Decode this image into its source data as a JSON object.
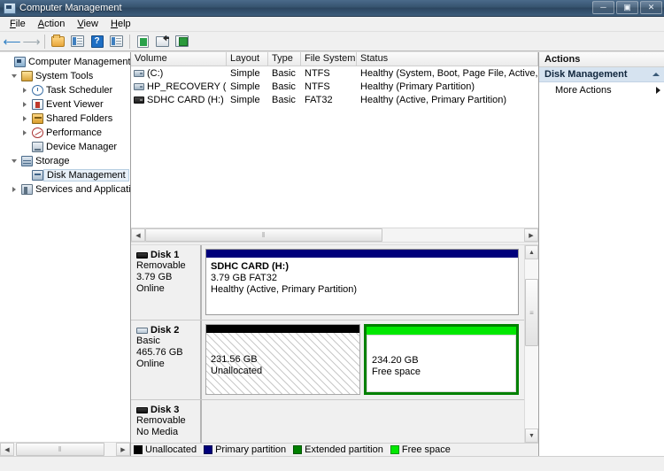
{
  "window": {
    "title": "Computer Management",
    "icon": "computer-management-icon",
    "buttons": {
      "minimize": "─",
      "maximize": "▣",
      "close": "✕"
    }
  },
  "menubar": {
    "items": [
      {
        "label": "File",
        "accel": "F"
      },
      {
        "label": "Action",
        "accel": "A"
      },
      {
        "label": "View",
        "accel": "V"
      },
      {
        "label": "Help",
        "accel": "H"
      }
    ]
  },
  "toolbar": {
    "buttons": [
      {
        "name": "back-icon",
        "glyph": "←"
      },
      {
        "name": "forward-icon",
        "glyph": "→"
      },
      {
        "name": "up-folder-icon",
        "glyph": ""
      },
      {
        "name": "show-hide-tree-icon",
        "glyph": ""
      },
      {
        "name": "help-icon",
        "glyph": "?"
      },
      {
        "name": "show-hide-actions-icon",
        "glyph": ""
      },
      {
        "name": "refresh-icon",
        "glyph": ""
      },
      {
        "name": "export-list-icon",
        "glyph": ""
      },
      {
        "name": "properties-icon",
        "glyph": ""
      }
    ]
  },
  "tree": {
    "root": {
      "label": "Computer Management (Local)",
      "icon": "computer-icon"
    },
    "items": [
      {
        "label": "System Tools",
        "icon": "system-tools-icon",
        "level": 1,
        "twisty": "open"
      },
      {
        "label": "Task Scheduler",
        "icon": "clock-icon",
        "level": 2,
        "twisty": "closed"
      },
      {
        "label": "Event Viewer",
        "icon": "event-viewer-icon",
        "level": 2,
        "twisty": "closed"
      },
      {
        "label": "Shared Folders",
        "icon": "shared-folders-icon",
        "level": 2,
        "twisty": "closed"
      },
      {
        "label": "Performance",
        "icon": "performance-icon",
        "level": 2,
        "twisty": "closed"
      },
      {
        "label": "Device Manager",
        "icon": "device-manager-icon",
        "level": 2,
        "twisty": "none"
      },
      {
        "label": "Storage",
        "icon": "storage-icon",
        "level": 1,
        "twisty": "open"
      },
      {
        "label": "Disk Management",
        "icon": "disk-management-icon",
        "level": 2,
        "twisty": "none",
        "selected": true
      },
      {
        "label": "Services and Applications",
        "icon": "services-icon",
        "level": 1,
        "twisty": "closed"
      }
    ]
  },
  "volume_list": {
    "columns": [
      "Volume",
      "Layout",
      "Type",
      "File System",
      "Status"
    ],
    "rows": [
      {
        "volume": "(C:)",
        "icon": "hard-disk-icon",
        "layout": "Simple",
        "type": "Basic",
        "filesystem": "NTFS",
        "status": "Healthy (System, Boot, Page File, Active, Crash Dump, Prim"
      },
      {
        "volume": "HP_RECOVERY (D:)",
        "icon": "hard-disk-icon",
        "layout": "Simple",
        "type": "Basic",
        "filesystem": "NTFS",
        "status": "Healthy (Primary Partition)"
      },
      {
        "volume": "SDHC CARD (H:)",
        "icon": "removable-disk-icon",
        "layout": "Simple",
        "type": "Basic",
        "filesystem": "FAT32",
        "status": "Healthy (Active, Primary Partition)"
      }
    ]
  },
  "disks": [
    {
      "name": "Disk 1",
      "glyph": "removable-disk-glyph",
      "type": "Removable",
      "capacity": "3.79 GB",
      "state": "Online",
      "partitions": [
        {
          "kind": "primary",
          "title": "SDHC CARD  (H:)",
          "size": "3.79 GB FAT32",
          "status": "Healthy (Active, Primary Partition)",
          "width_pct": 100
        }
      ]
    },
    {
      "name": "Disk 2",
      "glyph": "basic-disk-glyph",
      "type": "Basic",
      "capacity": "465.76 GB",
      "state": "Online",
      "partitions": [
        {
          "kind": "unalloc",
          "title": "",
          "size": "231.56 GB",
          "status": "Unallocated",
          "width_pct": 50
        },
        {
          "kind": "freespace",
          "title": "",
          "size": "234.20 GB",
          "status": "Free space",
          "width_pct": 50
        }
      ]
    },
    {
      "name": "Disk 3",
      "glyph": "removable-disk-glyph",
      "type": "Removable",
      "capacity": "",
      "state": "No Media",
      "partitions": []
    }
  ],
  "legend": {
    "items": [
      {
        "label": "Unallocated",
        "color": "#000000"
      },
      {
        "label": "Primary partition",
        "color": "#00007B"
      },
      {
        "label": "Extended partition",
        "color": "#008000"
      },
      {
        "label": "Free space",
        "color": "#00E800"
      }
    ]
  },
  "actions": {
    "header": "Actions",
    "group": "Disk Management",
    "items": [
      {
        "label": "More Actions"
      }
    ]
  },
  "scrollbars": {
    "vol_hscroll": {
      "left_arrow": "◀",
      "right_arrow": "▶",
      "grip": "‖"
    },
    "tree_hscroll": {
      "left_arrow": "◀",
      "right_arrow": "▶",
      "grip": "‖"
    },
    "disk_vscroll": {
      "up_arrow": "▲",
      "down_arrow": "▼",
      "grip": "≡"
    }
  }
}
